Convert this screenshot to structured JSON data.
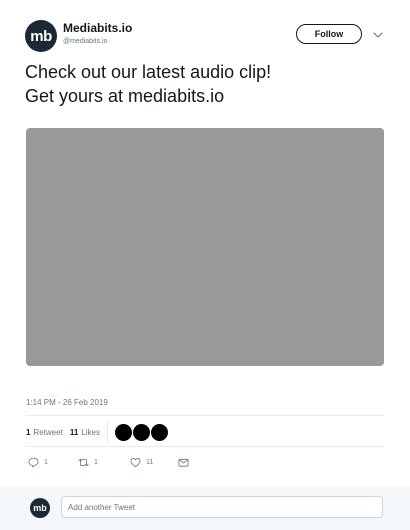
{
  "author": {
    "avatar_text": "mb",
    "display_name": "Mediabits.io",
    "handle": "@mediabits.io"
  },
  "header": {
    "follow_label": "Follow",
    "menu_icon": "chevron-down-icon"
  },
  "tweet": {
    "lines": [
      "Check out our latest audio clip!",
      "Get yours at mediabits.io"
    ],
    "timestamp": "1:14 PM - 26 Feb 2019"
  },
  "stats": {
    "retweets_count": "1",
    "retweets_label": "Retweet",
    "likes_count": "11",
    "likes_label": "Likes"
  },
  "actions": {
    "reply_icon": "reply-icon",
    "reply_count": "1",
    "retweet_icon": "retweet-icon",
    "retweet_count": "1",
    "like_icon": "heart-icon",
    "like_count": "11",
    "dm_icon": "envelope-icon"
  },
  "reply_bar": {
    "avatar_text": "mb",
    "placeholder": "Add another Tweet"
  },
  "colors": {
    "avatar_bg": "#1c2836",
    "media_bg": "#999999",
    "muted_text": "#657786",
    "reply_bar_bg": "#f5f8fa"
  }
}
